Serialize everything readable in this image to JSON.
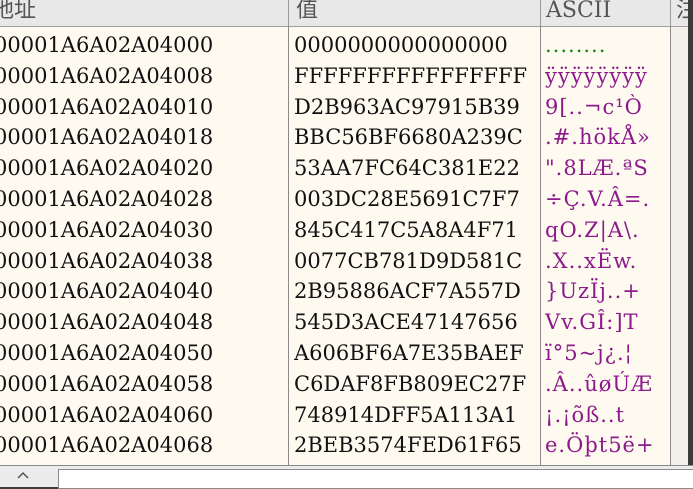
{
  "header": {
    "address_label": "地址",
    "value_label": "值",
    "ascii_label": "ASCII",
    "extra_label": "注"
  },
  "rows": [
    {
      "address": "00001A6A02A04000",
      "value": "0000000000000000",
      "ascii": "........"
    },
    {
      "address": "00001A6A02A04008",
      "value": "FFFFFFFFFFFFFFFF",
      "ascii": "ÿÿÿÿÿÿÿÿ"
    },
    {
      "address": "00001A6A02A04010",
      "value": "D2B963AC97915B39",
      "ascii": "9[..¬c¹Ò"
    },
    {
      "address": "00001A6A02A04018",
      "value": "BBC56BF6680A239C",
      "ascii": ".#.hökÅ»"
    },
    {
      "address": "00001A6A02A04020",
      "value": "53AA7FC64C381E22",
      "ascii": "\".8LÆ.ªS"
    },
    {
      "address": "00001A6A02A04028",
      "value": "003DC28E5691C7F7",
      "ascii": "÷Ç.V.Â=."
    },
    {
      "address": "00001A6A02A04030",
      "value": "845C417C5A8A4F71",
      "ascii": "qO.Z|A\\."
    },
    {
      "address": "00001A6A02A04038",
      "value": "0077CB781D9D581C",
      "ascii": ".X..xËw."
    },
    {
      "address": "00001A6A02A04040",
      "value": "2B95886ACF7A557D",
      "ascii": "}UzÏj..+"
    },
    {
      "address": "00001A6A02A04048",
      "value": "545D3ACE47147656",
      "ascii": "Vv.GÎ:]T"
    },
    {
      "address": "00001A6A02A04050",
      "value": "A606BF6A7E35BAEF",
      "ascii": "ï°5~j¿.¦"
    },
    {
      "address": "00001A6A02A04058",
      "value": "C6DAF8FB809EC27F",
      "ascii": ".Â..ûøÚÆ"
    },
    {
      "address": "00001A6A02A04060",
      "value": "748914DFF5A113A1",
      "ascii": "¡.¡õß..t"
    },
    {
      "address": "00001A6A02A04068",
      "value": "2BEB3574FED61F65",
      "ascii": "e.Öþt5ë+"
    }
  ]
}
